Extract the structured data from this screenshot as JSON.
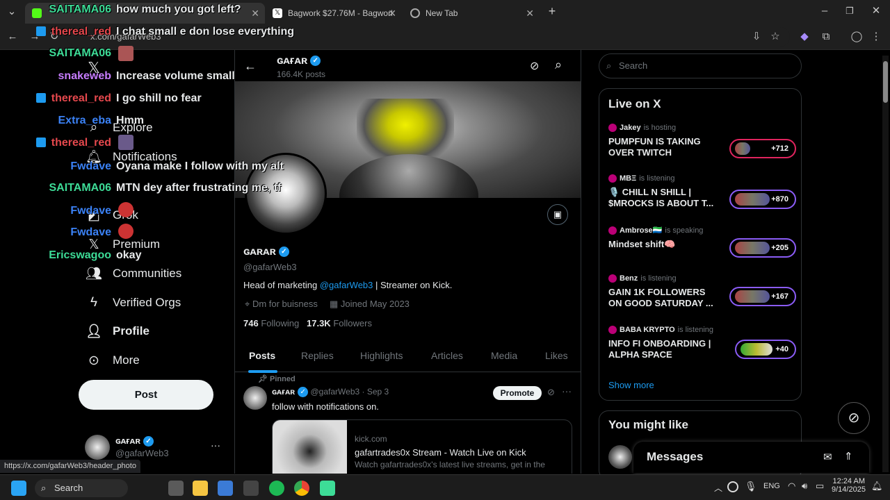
{
  "browser": {
    "tabs": [
      {
        "title": "",
        "active": true
      },
      {
        "title": "Bagwork $27.76M - Bagwork / S",
        "active": false
      },
      {
        "title": "New Tab",
        "active": false
      }
    ],
    "url": "x.com/gafarWeb3",
    "status_url": "https://x.com/gafarWeb3/header_photo"
  },
  "nav": {
    "items": [
      {
        "label": "Explore",
        "icon": "search-icon"
      },
      {
        "label": "Notifications",
        "icon": "bell-icon"
      },
      {
        "label": "Grok",
        "icon": "grok-icon"
      },
      {
        "label": "Premium",
        "icon": "x-logo-icon"
      },
      {
        "label": "Communities",
        "icon": "people-icon"
      },
      {
        "label": "Verified Orgs",
        "icon": "lightning-icon"
      },
      {
        "label": "Profile",
        "icon": "person-icon"
      },
      {
        "label": "More",
        "icon": "more-circle-icon"
      }
    ],
    "post_label": "Post",
    "account_name": "ɢᴀғᴀʀ",
    "account_handle": "@gafarWeb3",
    "more_dots": "···"
  },
  "profile": {
    "header_name": "ɢᴀғᴀʀ",
    "header_posts": "166.4K posts",
    "name": "ɢᴀʀᴀʀ",
    "handle": "@gafarWeb3",
    "bio_prefix": "Head of marketing ",
    "bio_link": "@gafarWeb3",
    "bio_suffix": " | Streamer on Kick.",
    "location": "Dm for buisness",
    "joined": "Joined May 2023",
    "following_count": "746",
    "following_label": "Following",
    "followers_count": "17.3K",
    "followers_label": "Followers"
  },
  "profile_tabs": [
    "Posts",
    "Replies",
    "Highlights",
    "Articles",
    "Media",
    "Likes"
  ],
  "pinned_post": {
    "pinned_label": "Pinned",
    "author": "ɢᴀғᴀʀ",
    "handle": "@gafarWeb3",
    "date": "· Sep 3",
    "promote_label": "Promote",
    "text": "follow with notifications on.",
    "card_domain": "kick.com",
    "card_title": "gafartrades0x Stream - Watch Live on Kick",
    "card_desc": "Watch gafartrades0x's latest live streams, get in the"
  },
  "sidebar": {
    "search_placeholder": "Search",
    "live_title": "Live on X",
    "live": [
      {
        "host": "Jakey",
        "status": "is hosting",
        "title": "PUMPFUN IS TAKING OVER TWITCH",
        "count": "+712"
      },
      {
        "host": "MBΞ",
        "status": "is listening",
        "title": "🎙️ CHILL N SHILL | $MROCKS IS ABOUT T...",
        "count": "+870"
      },
      {
        "host": "Ambrose🇸🇱",
        "status": "is speaking",
        "title": "Mindset shift🧠",
        "count": "+205"
      },
      {
        "host": "Benz",
        "status": "is listening",
        "title": "GAIN 1K FOLLOWERS ON GOOD SATURDAY ...",
        "count": "+167"
      },
      {
        "host": "BABA KRYPTO",
        "status": "is listening",
        "title": "INFO FI ONBOARDING | ALPHA SPACE",
        "count": "+40"
      }
    ],
    "show_more": "Show more",
    "you_might_like": "You might like",
    "messages": "Messages"
  },
  "chat": [
    {
      "user": "SAITAMA06",
      "color": "#3ddc97",
      "msg": "how much you got left?"
    },
    {
      "user": "thereal_red",
      "color": "#e5484d",
      "msg": "I chat small e don lose everything"
    },
    {
      "user": "SAITAMA06",
      "color": "#3ddc97",
      "msg": ""
    },
    {
      "user": "snakeweb",
      "color": "#c77dff",
      "msg": "Increase volume small"
    },
    {
      "user": "thereal_red",
      "color": "#e5484d",
      "msg": "I go shill no fear"
    },
    {
      "user": "Extra_eba",
      "color": "#3b82f6",
      "msg": "Hmm"
    },
    {
      "user": "thereal_red",
      "color": "#e5484d",
      "msg": ""
    },
    {
      "user": "Fwdave",
      "color": "#3b82f6",
      "msg": "Oyana make I follow with my alt"
    },
    {
      "user": "SAITAMA06",
      "color": "#3ddc97",
      "msg": "MTN dey after frustrating me, tf"
    },
    {
      "user": "Fwdave",
      "color": "#3b82f6",
      "msg": ""
    },
    {
      "user": "Fwdave",
      "color": "#3b82f6",
      "msg": ""
    },
    {
      "user": "Ericswagoo",
      "color": "#3ddc97",
      "msg": "okay"
    }
  ],
  "taskbar": {
    "search_label": "Search",
    "lang": "ENG",
    "time": "12:24 AM",
    "date": "9/14/2025"
  },
  "colors": {
    "accent_blue": "#1d9bf0",
    "live_border": "#8b5cf6",
    "bg": "#000000"
  }
}
